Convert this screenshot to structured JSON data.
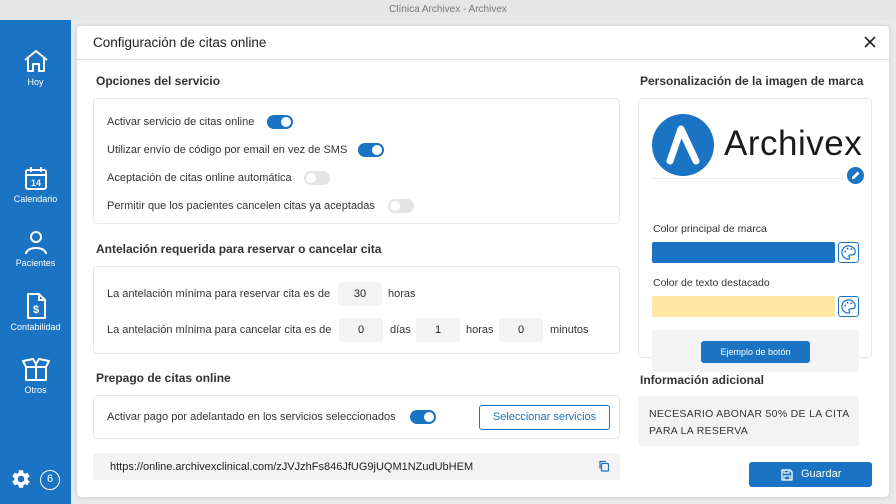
{
  "window": {
    "title": "Clínica Archivex - Archivex"
  },
  "sidebar": {
    "items": [
      {
        "label": "Hoy",
        "icon": "home-icon"
      },
      {
        "label": "Calendario",
        "icon": "calendar-icon",
        "badge": "14"
      },
      {
        "label": "Pacientes",
        "icon": "person-icon"
      },
      {
        "label": "Contabilidad",
        "icon": "invoice-icon"
      },
      {
        "label": "Otros",
        "icon": "box-icon"
      }
    ],
    "settings_icon": "gear-icon",
    "notification_count": "6",
    "color": "#1a73c3"
  },
  "modal": {
    "title": "Configuración de citas online",
    "close_icon": "close-icon",
    "service_options": {
      "title": "Opciones del servicio",
      "toggles": [
        {
          "label": "Activar servicio de citas online",
          "on": true
        },
        {
          "label": "Utilizar envío de código por email en vez de SMS",
          "on": true
        },
        {
          "label": "Aceptación de citas online automática",
          "on": false
        },
        {
          "label": "Permitir que los pacientes cancelen citas ya aceptadas",
          "on": false
        }
      ]
    },
    "advance": {
      "title": "Antelación requerida para reservar o cancelar cita",
      "reserve_label": "La antelación mínima para reservar cita es de",
      "reserve_hours": "30",
      "hours_unit": "horas",
      "cancel_label": "La antelación mínima para cancelar cita es de",
      "cancel_days": "0",
      "days_unit": "días",
      "cancel_hours": "1",
      "cancel_minutes": "0",
      "minutes_unit": "minutos"
    },
    "prepay": {
      "title": "Prepago de citas online",
      "toggle_label": "Activar pago por adelantado en los servicios seleccionados",
      "toggle_on": true,
      "select_button": "Seleccionar servicios"
    },
    "url": "https://online.archivexclinical.com/zJVJzhFs846JfUG9jUQM1NZudUbHEM",
    "branding": {
      "title": "Personalización de la imagen de marca",
      "logo_text": "Archivex",
      "primary_color_label": "Color principal de marca",
      "primary_color": "#1a73c3",
      "highlight_color_label": "Color de texto destacado",
      "highlight_color": "#fde8a4",
      "example_button": "Ejemplo de botón"
    },
    "additional_info": {
      "title": "Información adicional",
      "text": "NECESARIO ABONAR 50% DE LA CITA PARA LA RESERVA"
    },
    "save_button": "Guardar"
  }
}
